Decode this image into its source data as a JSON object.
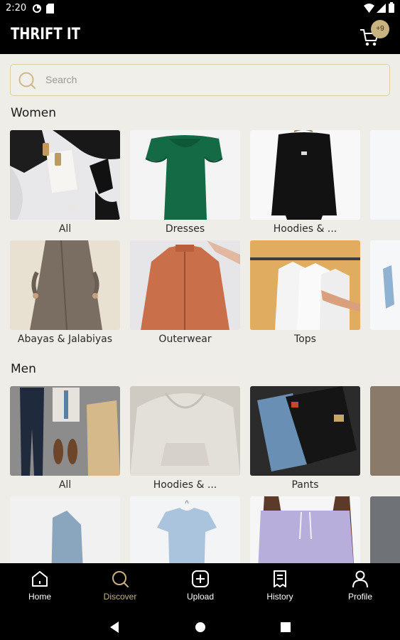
{
  "status_bar": {
    "time": "2:20"
  },
  "header": {
    "title": "THRIFT IT",
    "cart_badge": "+9"
  },
  "search": {
    "placeholder": "Search"
  },
  "sections": {
    "women": {
      "title": "Women",
      "items": [
        {
          "label": "All",
          "icon": "jewelry-photo"
        },
        {
          "label": "Dresses",
          "icon": "green-dress-photo"
        },
        {
          "label": "Hoodies & ...",
          "icon": "black-sweater-photo"
        },
        {
          "label": "Abayas & Jalabiyas",
          "icon": "abaya-photo"
        },
        {
          "label": "Outerwear",
          "icon": "jacket-photo"
        },
        {
          "label": "Tops",
          "icon": "shirts-rack-photo"
        }
      ]
    },
    "men": {
      "title": "Men",
      "items": [
        {
          "label": "All",
          "icon": "outfit-flatlay-photo"
        },
        {
          "label": "Hoodies & ...",
          "icon": "hoodie-photo"
        },
        {
          "label": "Pants",
          "icon": "jeans-photo"
        }
      ]
    }
  },
  "bottom_nav": {
    "items": [
      {
        "label": "Home",
        "icon": "home-icon"
      },
      {
        "label": "Discover",
        "icon": "search-icon",
        "active": true
      },
      {
        "label": "Upload",
        "icon": "add-icon"
      },
      {
        "label": "History",
        "icon": "receipt-icon"
      },
      {
        "label": "Profile",
        "icon": "profile-icon"
      }
    ]
  },
  "colors": {
    "accent": "#c8b27f",
    "background": "#efede8",
    "bar": "#000000"
  }
}
